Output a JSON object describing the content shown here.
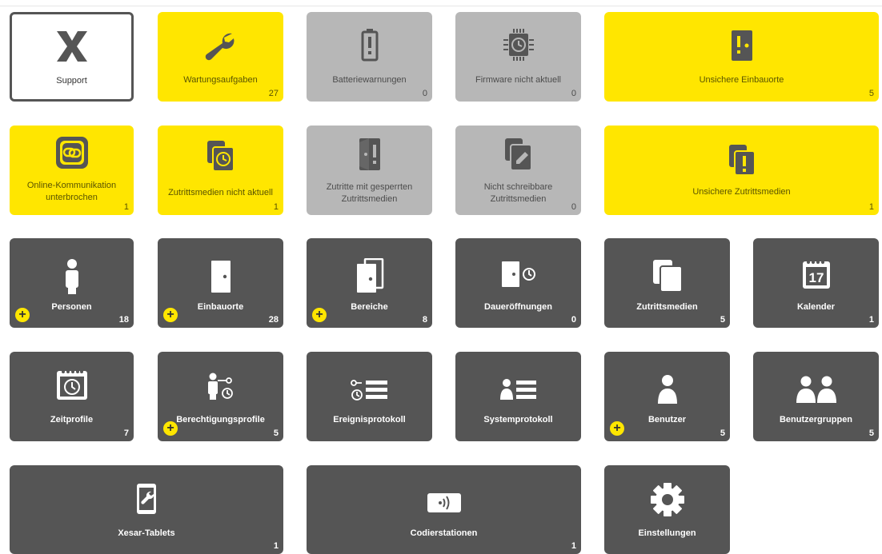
{
  "tiles": {
    "support": {
      "label": "Support",
      "icon": "x-icon"
    },
    "maintenance": {
      "label": "Wartungsaufgaben",
      "count": "27",
      "icon": "wrench-icon"
    },
    "battery": {
      "label": "Batteriewarnungen",
      "count": "0",
      "icon": "battery-warning-icon"
    },
    "firmware": {
      "label": "Firmware nicht aktuell",
      "count": "0",
      "icon": "chip-clock-icon"
    },
    "unsafe_locations": {
      "label": "Unsichere Einbauorte",
      "count": "5",
      "icon": "door-warning-icon"
    },
    "online": {
      "label": "Online-Kommunikation unterbrochen",
      "count": "1",
      "icon": "link-icon"
    },
    "media_outdated": {
      "label": "Zutrittsmedien nicht aktuell",
      "count": "1",
      "icon": "media-clock-icon"
    },
    "blocked_access": {
      "label": "Zutritte mit gesperrten Zutrittsmedien",
      "icon": "door-exclamation-icon"
    },
    "unwritable": {
      "label": "Nicht schreibbare Zutrittsmedien",
      "count": "0",
      "icon": "media-pen-icon"
    },
    "unsafe_media": {
      "label": "Unsichere Zutrittsmedien",
      "count": "1",
      "icon": "media-warning-icon"
    },
    "persons": {
      "label": "Personen",
      "count": "18",
      "icon": "person-icon"
    },
    "locations": {
      "label": "Einbauorte",
      "count": "28",
      "icon": "door-icon"
    },
    "areas": {
      "label": "Bereiche",
      "count": "8",
      "icon": "doors-icon"
    },
    "permanent_open": {
      "label": "Daueröffnungen",
      "count": "0",
      "icon": "door-clock-icon"
    },
    "access_media": {
      "label": "Zutrittsmedien",
      "count": "5",
      "icon": "cards-icon"
    },
    "calendar": {
      "label": "Kalender",
      "count": "1",
      "icon": "calendar-icon",
      "day": "17"
    },
    "time_profiles": {
      "label": "Zeitprofile",
      "count": "7",
      "icon": "calendar-clock-icon"
    },
    "permission_profiles": {
      "label": "Berechtigungsprofile",
      "count": "5",
      "icon": "person-key-clock-icon"
    },
    "event_log": {
      "label": "Ereignisprotokoll",
      "icon": "key-clock-list-icon"
    },
    "system_log": {
      "label": "Systemprotokoll",
      "icon": "person-list-icon"
    },
    "users": {
      "label": "Benutzer",
      "count": "5",
      "icon": "user-icon"
    },
    "user_groups": {
      "label": "Benutzergruppen",
      "count": "5",
      "icon": "users-icon"
    },
    "tablets": {
      "label": "Xesar-Tablets",
      "count": "1",
      "icon": "tablet-wrench-icon"
    },
    "coding_stations": {
      "label": "Codierstationen",
      "count": "1",
      "icon": "coding-station-icon"
    },
    "settings": {
      "label": "Einstellungen",
      "icon": "gear-icon"
    }
  },
  "colors": {
    "yellow": "#ffe600",
    "gray": "#b7b7b7",
    "dark": "#555555"
  }
}
